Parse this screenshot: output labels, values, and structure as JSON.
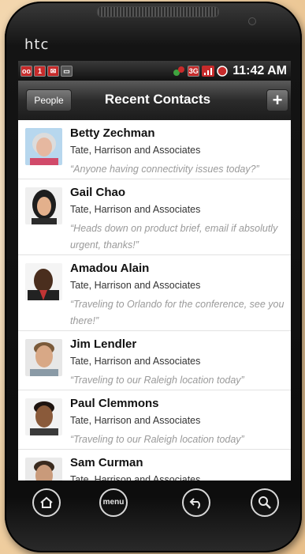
{
  "device": {
    "brand": "htc"
  },
  "status_bar": {
    "time": "11:42 AM",
    "notification_badge": "1",
    "accent": "#c72b2b"
  },
  "title_bar": {
    "left_button": "People",
    "title": "Recent Contacts",
    "right_button": "+"
  },
  "contacts": [
    {
      "name": "Betty Zechman",
      "company": "Tate, Harrison and Associates",
      "status": "“Anyone having connectivity issues today?”"
    },
    {
      "name": "Gail Chao",
      "company": "Tate, Harrison and Associates",
      "status": "“Heads down on product brief, email if absolutly urgent, thanks!”"
    },
    {
      "name": "Amadou Alain",
      "company": "Tate, Harrison and Associates",
      "status": "“Traveling to Orlando for the conference, see you there!”"
    },
    {
      "name": "Jim Lendler",
      "company": "Tate, Harrison and Associates",
      "status": "“Traveling to our Raleigh location today”"
    },
    {
      "name": "Paul Clemmons",
      "company": "Tate, Harrison and Associates",
      "status": "“Traveling to our Raleigh location today”"
    },
    {
      "name": "Sam Curman",
      "company": "Tate, Harrison and Associates",
      "status": ""
    }
  ],
  "hardware_buttons": {
    "home": "home-icon",
    "menu": "menu",
    "back": "back-icon",
    "search": "search-icon"
  }
}
